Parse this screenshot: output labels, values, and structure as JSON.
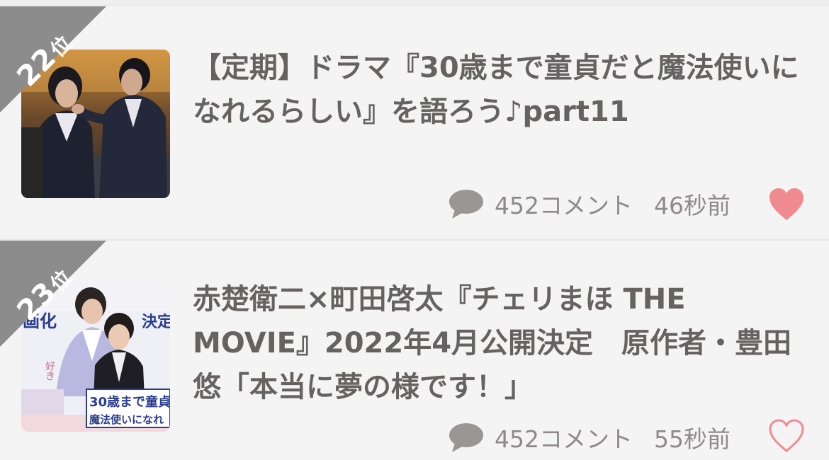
{
  "colors": {
    "background": "#f5f4f4",
    "rank_badge": "#8c8c8c",
    "title_text": "#666262",
    "meta_text": "#8e8a8a",
    "like_active": "#f08a91",
    "like_inactive": "#f08a91"
  },
  "articles": [
    {
      "rank": "22",
      "rank_suffix": "位",
      "title": "【定期】ドラマ『30歳まで童貞だと魔法使いになれるらしい』を語ろう♪part11",
      "comments": "452コメント",
      "time": "46秒前",
      "liked": true,
      "comment_icon": "speech-bubble-icon",
      "like_icon": "heart-filled-icon"
    },
    {
      "rank": "23",
      "rank_suffix": "位",
      "title": "赤楚衛二×町田啓太『チェリまほ THE MOVIE』2022年4月公開決定　原作者・豊田悠「本当に夢の様です！」",
      "comments": "452コメント",
      "time": "55秒前",
      "liked": false,
      "comment_icon": "speech-bubble-icon",
      "like_icon": "heart-outline-icon",
      "thumbnail_text": {
        "left": "画化",
        "right": "決定",
        "vertical": "好き",
        "logo_line1": "30歳まで童貞",
        "logo_line2": "魔法使いになれ"
      }
    }
  ]
}
